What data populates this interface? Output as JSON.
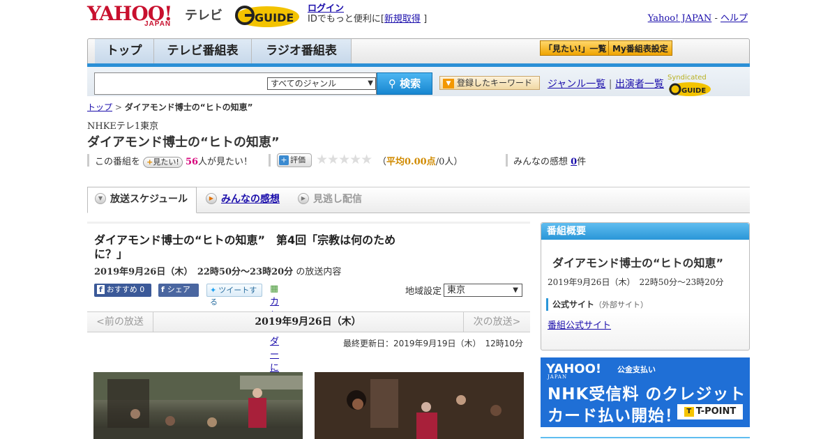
{
  "header": {
    "logo_yahoo": "YAHOO!",
    "logo_japan": "JAPAN",
    "logo_tv": "テレビ",
    "gguide": "GUIDE",
    "login": "ログイン",
    "login_sub_prefix": "IDでもっと便利に[",
    "signup": "新規取得",
    "login_sub_suffix": "]",
    "yahoo_japan": "Yahoo! JAPAN",
    "help_sep": " - ",
    "help": "ヘルプ"
  },
  "nav": {
    "tabs": [
      "トップ",
      "テレビ番組表",
      "ラジオ番組表"
    ],
    "btn_mitai_list": "「見たい!」一覧",
    "btn_my": "My番組表設定"
  },
  "search": {
    "genre": "すべてのジャンル",
    "button": "検索",
    "keyword_btn": "登録したキーワード",
    "genre_list": "ジャンル一覧",
    "sep": "|",
    "cast_list": "出演者一覧",
    "syndicated": "Syndicated"
  },
  "breadcrumb": {
    "top": "トップ",
    "arrow": " > ",
    "current": "ダイアモンド博士の“ヒトの知恵”"
  },
  "program": {
    "station": "NHKEテレ1東京",
    "title": "ダイアモンド博士の“ヒトの知恵”",
    "mitai_prefix": "この番組を",
    "mitai_btn": "見たい!",
    "mitai_count": "56",
    "mitai_suffix": "人が見たい！",
    "hyoka_btn": "評価",
    "stars": "★★★★★",
    "avg_prefix": "（",
    "avg_value": "平均0.00点",
    "avg_suffix": "/0人）",
    "kanso_label": "みんなの感想 ",
    "kanso_count": "0",
    "kanso_suffix": "件"
  },
  "tabs": {
    "schedule": "放送スケジュール",
    "kanso": "みんなの感想",
    "minogashi": "見逃し配信"
  },
  "episode": {
    "title": "ダイアモンド博士の“ヒトの知恵”　第4回「宗教は何のために？」",
    "date": "2019年9月26日（木）　22時50分～23時20分",
    "date_suffix": "の放送内容",
    "fb_recommend": "おすすめ 0",
    "fb_share": "シェア",
    "tweet": "ツイートする",
    "calendar": "カレンダーに登録",
    "region_label": "地域設定",
    "region_value": "東京",
    "prev": "<前の放送",
    "current_date": "2019年9月26日（木）",
    "next": "次の放送>",
    "updated": "最終更新日：2019年9月19日（木）　12時10分"
  },
  "sidebar": {
    "head": "番組概要",
    "title": "ダイアモンド博士の“ヒトの知恵”",
    "date": "2019年9月26日（木）　22時50分～23時20分",
    "official_label": "公式サイト",
    "official_note": "（外部サイト）",
    "official_link": "番組公式サイト"
  },
  "ad": {
    "yahoo": "YAHOO!",
    "japan": "JAPAN",
    "small": "公金支払い",
    "line1": "NHK受信料 のクレジット",
    "line2": "カード払い開始！",
    "tpoint": "T-POINT",
    "tpoint_mark": "T"
  },
  "colors": {
    "accent_blue": "#2a96d8",
    "yahoo_red": "#c8102e",
    "pink": "#d6007a"
  }
}
